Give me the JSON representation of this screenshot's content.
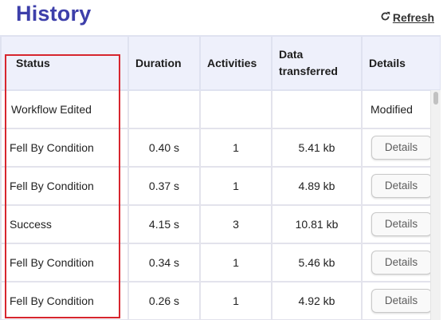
{
  "header": {
    "title": "History",
    "refresh_label": "Refresh",
    "refresh_icon": "refresh-icon"
  },
  "table": {
    "columns": {
      "status": "Status",
      "duration": "Duration",
      "activities": "Activities",
      "data_transferred": "Data transferred",
      "details": "Details"
    },
    "rows": [
      {
        "status": "Workflow Edited",
        "duration": "",
        "activities": "",
        "data": "",
        "details_text": "Modified"
      },
      {
        "status": "Fell By Condition",
        "duration": "0.40 s",
        "activities": "1",
        "data": "5.41 kb",
        "details_button": "Details"
      },
      {
        "status": "Fell By Condition",
        "duration": "0.37 s",
        "activities": "1",
        "data": "4.89 kb",
        "details_button": "Details"
      },
      {
        "status": "Success",
        "duration": "4.15 s",
        "activities": "3",
        "data": "10.81 kb",
        "details_button": "Details"
      },
      {
        "status": "Fell By Condition",
        "duration": "0.34 s",
        "activities": "1",
        "data": "5.46 kb",
        "details_button": "Details"
      },
      {
        "status": "Fell By Condition",
        "duration": "0.26 s",
        "activities": "1",
        "data": "4.92 kb",
        "details_button": "Details"
      }
    ]
  },
  "colors": {
    "title": "#3d3faa",
    "header_bg": "#eef0fb",
    "highlight": "#d7262e"
  }
}
